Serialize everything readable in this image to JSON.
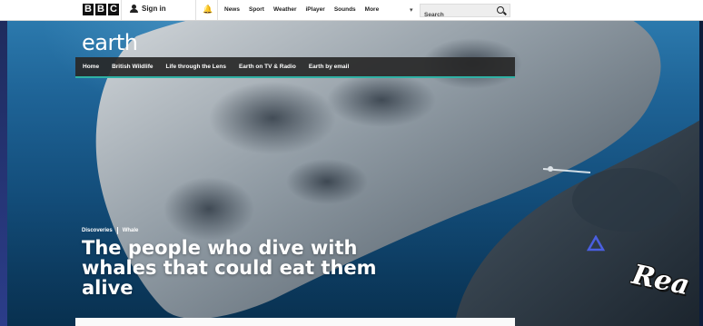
{
  "topbar": {
    "logo_letters": [
      "B",
      "B",
      "C"
    ],
    "signin_label": "Sign in",
    "nav_items": [
      "News",
      "Sport",
      "Weather",
      "iPlayer",
      "Sounds",
      "More"
    ],
    "search_placeholder": "Search"
  },
  "brand": {
    "logo_text": "earth",
    "nav_items": [
      "Home",
      "British Wildlife",
      "Life through the Lens",
      "Earth on TV & Radio",
      "Earth by email"
    ]
  },
  "article": {
    "tags": [
      "Discoveries",
      "Whale"
    ],
    "headline": "The people who dive with whales that could eat them alive"
  },
  "overlay": {
    "text": "Rea",
    "accent_color": "#4a5fe0"
  },
  "colors": {
    "nav_underline": "#2fb1a5",
    "nav_background": "#282828"
  }
}
